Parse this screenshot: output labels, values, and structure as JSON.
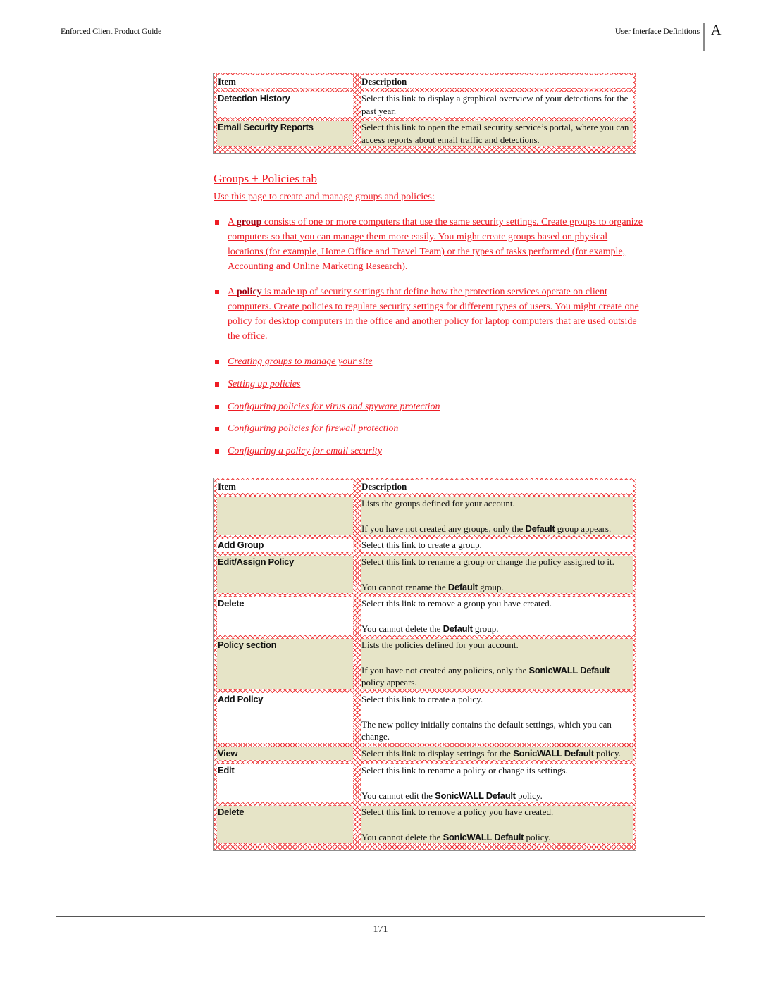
{
  "header": {
    "doc_title": "Enforced Client Product Guide",
    "section_title": "User Interface Definitions",
    "appendix_letter": "A"
  },
  "table1": {
    "columns": [
      "Item",
      "Description"
    ],
    "rows": [
      {
        "item": "Detection History",
        "shade": "white",
        "desc": [
          "Select this link to display a graphical overview of your detections for the past year."
        ]
      },
      {
        "item": "Email Security Reports",
        "shade": "tan",
        "desc": [
          "Select this link to open the email security service’s portal, where you can access reports about email traffic and detections."
        ]
      }
    ]
  },
  "section": {
    "title": "Groups + Policies tab",
    "intro": "Use this page to create and manage groups and policies:",
    "bullets": [
      {
        "prefix": "A ",
        "keyword": "group",
        "text": " consists of one or more computers that use the same security settings. Create groups to organize computers so that you can manage them more easily. You might create groups based on physical locations (for example, Home Office and Travel Team) or the types of tasks performed (for example, Accounting and Online Marketing Research)."
      },
      {
        "prefix": "A ",
        "keyword": "policy",
        "text": " is made up of security settings that define how the protection services operate on client computers. Create policies to regulate security settings for different types of users. You might create one policy for desktop computers in the office and another policy for laptop computers that are used outside the office."
      }
    ],
    "links": [
      "Creating groups to manage your site",
      "Setting up policies",
      "Configuring policies for virus and spyware protection",
      "Configuring policies for firewall protection",
      "Configuring a policy for email security"
    ]
  },
  "table2": {
    "columns": [
      "Item",
      "Description"
    ],
    "rows": [
      {
        "item": "",
        "shade": "tan",
        "desc": [
          "Lists the groups defined for your account.",
          [
            "If you have not created any groups, only the ",
            "Default",
            " group appears."
          ]
        ]
      },
      {
        "item": "Add Group",
        "shade": "white",
        "desc": [
          "Select this link to create a group."
        ]
      },
      {
        "item": "Edit/Assign Policy",
        "shade": "tan",
        "desc": [
          "Select this link to rename a group or change the policy assigned to it.",
          [
            "You cannot rename the ",
            "Default",
            " group."
          ]
        ]
      },
      {
        "item": "Delete",
        "shade": "white",
        "desc": [
          "Select this link to remove a group you have created.",
          [
            "You cannot delete the ",
            "Default",
            " group."
          ]
        ]
      },
      {
        "item": "Policy section",
        "shade": "tan",
        "desc": [
          "Lists the policies defined for your account.",
          [
            "If you have not created any policies, only the ",
            "SonicWALL Default",
            " policy appears."
          ]
        ]
      },
      {
        "item": "Add Policy",
        "shade": "white",
        "desc": [
          "Select this link to create a policy.",
          "The new policy initially contains the default settings, which you can change."
        ]
      },
      {
        "item": "View",
        "shade": "tan",
        "desc": [
          [
            "Select this link to display settings for the ",
            "SonicWALL Default",
            " policy."
          ]
        ]
      },
      {
        "item": "Edit",
        "shade": "white",
        "desc": [
          "Select this link to rename a policy or change its settings.",
          [
            "You cannot edit the ",
            "SonicWALL Default",
            " policy."
          ]
        ]
      },
      {
        "item": "Delete",
        "shade": "tan",
        "desc": [
          "Select this link to remove a policy you have created.",
          [
            "You cannot delete the ",
            "SonicWALL Default",
            " policy."
          ]
        ]
      }
    ]
  },
  "footer": {
    "page_number": "171"
  },
  "colors": {
    "link_red": "#ee1c24",
    "hatch_red": "#ee3a3a",
    "row_tan": "#e6e4c7"
  }
}
